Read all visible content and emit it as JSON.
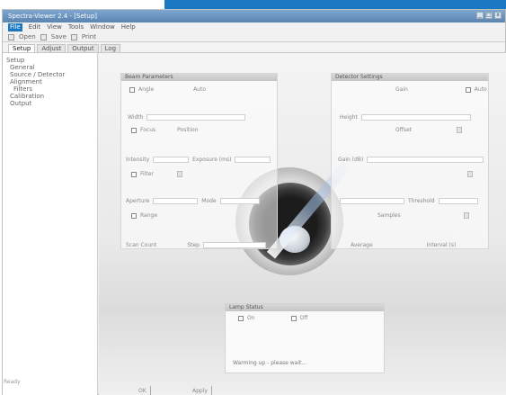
{
  "window": {
    "title": "Spectra-Viewer 2.4 - [Setup]",
    "controls": [
      "_",
      "□",
      "x"
    ]
  },
  "menu": [
    "File",
    "Edit",
    "View",
    "Tools",
    "Window",
    "Help"
  ],
  "toolbar": {
    "labels": [
      "Open",
      "Save",
      "Print"
    ]
  },
  "tabs": [
    "Setup",
    "Adjust",
    "Output",
    "Log"
  ],
  "sidebar": {
    "items": [
      {
        "label": "Setup",
        "level": 0
      },
      {
        "label": "General",
        "level": 1
      },
      {
        "label": "Source / Detector",
        "level": 1
      },
      {
        "label": "Alignment",
        "level": 1
      },
      {
        "label": "Filters",
        "level": 2
      },
      {
        "label": "Calibration",
        "level": 1
      },
      {
        "label": "Output",
        "level": 1
      }
    ]
  },
  "panels": {
    "left": {
      "title": "Beam Parameters",
      "label_a": "Angle",
      "label_b": "Auto"
    },
    "right": {
      "title": "Detector Settings",
      "label_a": "Gain",
      "label_b": "Auto"
    }
  },
  "fields": {
    "row1_left": "Width",
    "row1_right": "Height",
    "row2_left": "Focus",
    "row2_mid": "Position",
    "row2_right": "Offset",
    "row3_left": "Intensity",
    "row3_mid": "Exposure (ms)",
    "row3_right": "Gain (dB)",
    "row4_left": "Filter",
    "row4_mid": "Mode",
    "row4_right": "Threshold",
    "row5_left": "Aperture",
    "row5_mid": "Range",
    "row5_right": "Samples",
    "row6_left": "Scan Count",
    "row6_mid": "Step",
    "row6_right": "Average",
    "row6_far": "Interval (s)"
  },
  "bottom_panel": {
    "title": "Lamp Status",
    "on_label": "On",
    "off_label": "Off",
    "note": "Warming up - please wait..."
  },
  "footer": {
    "ok": "OK",
    "apply": "Apply"
  },
  "status": "Ready"
}
